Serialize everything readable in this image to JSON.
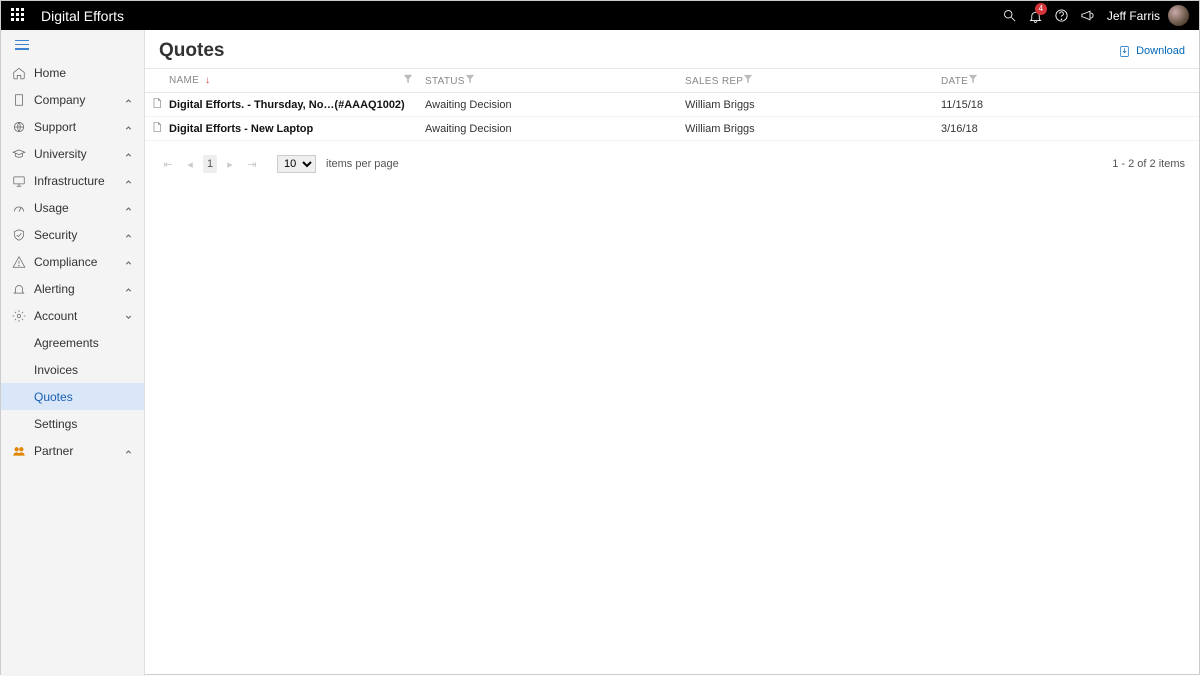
{
  "header": {
    "app_title": "Digital Efforts",
    "notif_count": "4",
    "user_name": "Jeff Farris"
  },
  "sidebar": {
    "items": [
      {
        "label": "Home"
      },
      {
        "label": "Company"
      },
      {
        "label": "Support"
      },
      {
        "label": "University"
      },
      {
        "label": "Infrastructure"
      },
      {
        "label": "Usage"
      },
      {
        "label": "Security"
      },
      {
        "label": "Compliance"
      },
      {
        "label": "Alerting"
      },
      {
        "label": "Account"
      },
      {
        "label": "Partner"
      }
    ],
    "account_sub": [
      {
        "label": "Agreements"
      },
      {
        "label": "Invoices"
      },
      {
        "label": "Quotes"
      },
      {
        "label": "Settings"
      }
    ]
  },
  "page": {
    "title": "Quotes",
    "download_label": "Download"
  },
  "table": {
    "columns": {
      "name": "NAME",
      "status": "STATUS",
      "rep": "SALES REP",
      "date": "DATE"
    },
    "rows": [
      {
        "name": "Digital Efforts. - Thursday, No…(#AAAQ1002)",
        "status": "Awaiting Decision",
        "rep": "William Briggs",
        "date": "11/15/18"
      },
      {
        "name": "Digital Efforts - New Laptop",
        "status": "Awaiting Decision",
        "rep": "William Briggs",
        "date": "3/16/18"
      }
    ]
  },
  "pager": {
    "page": "1",
    "size": "10",
    "items_label": "items per page",
    "summary": "1 - 2 of 2 items"
  }
}
